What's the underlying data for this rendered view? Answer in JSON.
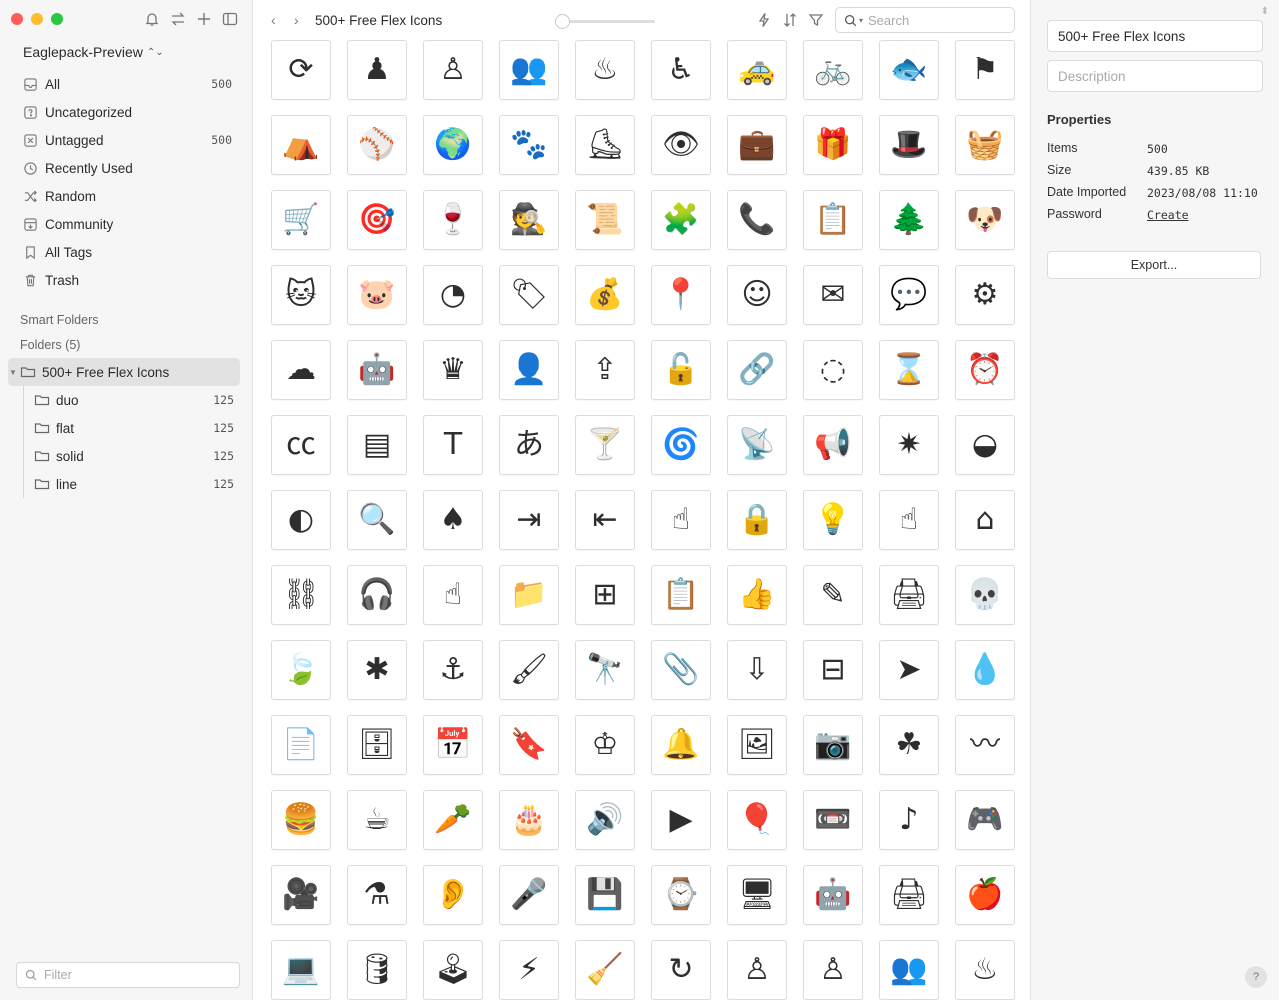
{
  "sidebar": {
    "library_name": "Eaglepack-Preview",
    "items": [
      {
        "label": "All",
        "count": "500",
        "icon": "inbox-icon"
      },
      {
        "label": "Uncategorized",
        "count": "",
        "icon": "question-box-icon"
      },
      {
        "label": "Untagged",
        "count": "500",
        "icon": "untagged-icon"
      },
      {
        "label": "Recently Used",
        "count": "",
        "icon": "clock-icon"
      },
      {
        "label": "Random",
        "count": "",
        "icon": "shuffle-icon"
      },
      {
        "label": "Community",
        "count": "",
        "icon": "download-box-icon"
      },
      {
        "label": "All Tags",
        "count": "",
        "icon": "bookmark-icon"
      },
      {
        "label": "Trash",
        "count": "",
        "icon": "trash-icon"
      }
    ],
    "smart_folders_label": "Smart Folders",
    "folders_label": "Folders (5)",
    "folders": [
      {
        "label": "500+ Free Flex Icons",
        "count": ""
      },
      {
        "label": "duo",
        "count": "125"
      },
      {
        "label": "flat",
        "count": "125"
      },
      {
        "label": "solid",
        "count": "125"
      },
      {
        "label": "line",
        "count": "125"
      }
    ],
    "filter_placeholder": "Filter"
  },
  "toolbar": {
    "folder_title": "500+ Free Flex Icons",
    "back": "‹",
    "forward": "›",
    "search_placeholder": "Search",
    "zoom_level": 0
  },
  "icons": [
    "⟳",
    "♟",
    "♙",
    "👥",
    "♨",
    "♿",
    "🚕",
    "🚲",
    "🐟",
    "⚑",
    "⛺",
    "⚾",
    "🌍",
    "🐾",
    "⛸",
    "👁",
    "💼",
    "🎁",
    "🎩",
    "🧺",
    "🛒",
    "🎯",
    "🍷",
    "🕵",
    "📜",
    "🧩",
    "📞",
    "📋",
    "🌲",
    "🐶",
    "🐱",
    "🐷",
    "◔",
    "🏷",
    "💰",
    "📍",
    "☺",
    "✉",
    "💬",
    "⚙",
    "☁",
    "🤖",
    "♛",
    "👤",
    "⇪",
    "🔓",
    "🔗",
    "◌",
    "⌛",
    "⏰",
    "㏄",
    "▤",
    "T",
    "あ",
    "🍸",
    "🌀",
    "📡",
    "📢",
    "✷",
    "◒",
    "◐",
    "🔍",
    "♠",
    "⇥",
    "⇤",
    "☝",
    "🔒",
    "💡",
    "☝",
    "⌂",
    "⛓",
    "🎧",
    "☝",
    "📁",
    "⊞",
    "📋",
    "👍",
    "✎",
    "🖨",
    "💀",
    "🍃",
    "✱",
    "⚓",
    "🖌",
    "🔭",
    "📎",
    "⇩",
    "⊟",
    "➤",
    "💧",
    "📄",
    "🗄",
    "📅",
    "🔖",
    "♔",
    "🔔",
    "🖼",
    "📷",
    "☘",
    "〰",
    "🍔",
    "☕",
    "🥕",
    "🎂",
    "🔊",
    "▶",
    "🎈",
    "📼",
    "♪",
    "🎮",
    "🎥",
    "⚗",
    "👂",
    "🎤",
    "💾",
    "⌚",
    "🖥",
    "🤖",
    "🖨",
    "🍎",
    "💻",
    "🛢",
    "🕹",
    "⚡",
    "🧹",
    "↻",
    "♙",
    "♙",
    "👥",
    "♨"
  ],
  "panel": {
    "name": "500+ Free Flex Icons",
    "description_placeholder": "Description",
    "properties_title": "Properties",
    "props": [
      {
        "label": "Items",
        "value": "500"
      },
      {
        "label": "Size",
        "value": "439.85 KB"
      },
      {
        "label": "Date Imported",
        "value": "2023/08/08 11:10"
      },
      {
        "label": "Password",
        "value": "Create"
      }
    ],
    "export_label": "Export...",
    "help": "?"
  },
  "colors": {
    "sidebar_bg": "#f6f6f6",
    "active_folder_bg": "#e2e2e2",
    "icon_fill": "#2e2e2e"
  }
}
